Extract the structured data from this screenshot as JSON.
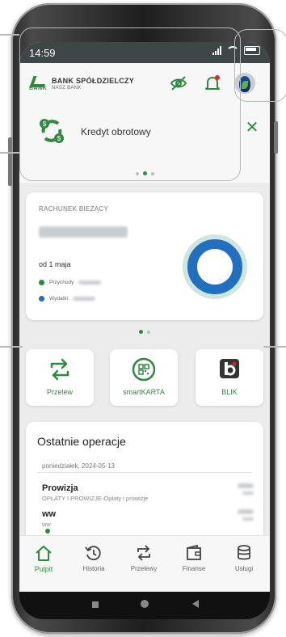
{
  "status_bar": {
    "time": "14:59"
  },
  "header": {
    "bank_name": "BANK SPÓŁDZIELCZY",
    "bank_sub": "NASZ BANK",
    "logo_word": "BANK"
  },
  "promo": {
    "label": "Kredyt obrotowy"
  },
  "account": {
    "title": "RACHUNEK BIEŻĄCY",
    "since_label": "od 1 maja",
    "income_label": "Przychody",
    "expense_label": "Wydatki",
    "chart": {
      "type": "donut",
      "income_share": 0.0,
      "expense_share": 1.0
    }
  },
  "quick_actions": {
    "transfer": "Przelew",
    "smartkarta": "smartKARTA",
    "blik": "BLIK"
  },
  "recent_ops": {
    "title": "Ostatnie operacje",
    "date": "poniedziałek, 2024-05-13",
    "items": [
      {
        "name": "Prowizja",
        "desc": "OPŁATY I PROWIZJE-Opłaty i prowizje"
      },
      {
        "name": "ww",
        "desc": "ww"
      }
    ]
  },
  "bottom_nav": {
    "pulpit": "Pulpit",
    "historia": "Historia",
    "przelewy": "Przelewy",
    "finanse": "Finanse",
    "uslugi": "Usługi"
  },
  "colors": {
    "accent": "#2e8b3e",
    "status_bar": "#3f4648",
    "donut_blue": "#1f6fc2",
    "donut_track": "#cfe6dc",
    "notification": "#e02424"
  }
}
